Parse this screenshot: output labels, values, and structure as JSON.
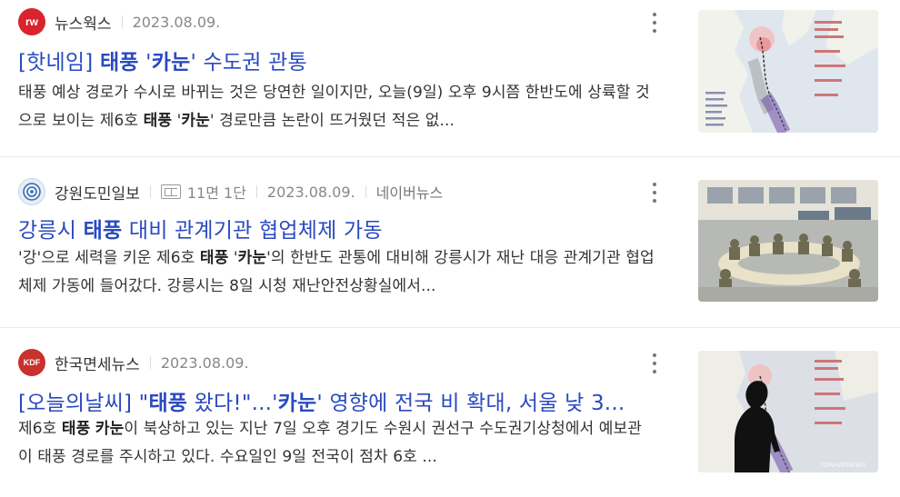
{
  "results": [
    {
      "source": "뉴스웍스",
      "date": "2023.08.09.",
      "title_parts": [
        {
          "text": "[핫네임] ",
          "bold": false
        },
        {
          "text": "태풍",
          "bold": true
        },
        {
          "text": " '",
          "bold": false
        },
        {
          "text": "카눈",
          "bold": true
        },
        {
          "text": "' 수도권 관통",
          "bold": false
        }
      ],
      "desc_parts": [
        {
          "text": "태풍 예상 경로가 수시로 바뀌는 것은 당연한 일이지만, 오늘(9일) 오후 9시쯤 한반도에 상륙할 것으로 보이는 제6호 ",
          "bold": false
        },
        {
          "text": "태풍",
          "bold": true
        },
        {
          "text": " '",
          "bold": false
        },
        {
          "text": "카눈",
          "bold": true
        },
        {
          "text": "' 경로만큼 논란이 뜨거웠던 적은 없...",
          "bold": false
        }
      ],
      "icon_color": "#d9232d",
      "icon_glyph": "rw"
    },
    {
      "source": "강원도민일보",
      "paper_section": "11면 1단",
      "date": "2023.08.09.",
      "portal": "네이버뉴스",
      "title_parts": [
        {
          "text": "강릉시 ",
          "bold": false
        },
        {
          "text": "태풍",
          "bold": true
        },
        {
          "text": " 대비 관계기관 협업체제 가동",
          "bold": false
        }
      ],
      "desc_parts": [
        {
          "text": "'강'으로 세력을 키운 제6호 ",
          "bold": false
        },
        {
          "text": "태풍",
          "bold": true
        },
        {
          "text": " '",
          "bold": false
        },
        {
          "text": "카눈",
          "bold": true
        },
        {
          "text": "'의 한반도 관통에 대비해 강릉시가 재난 대응 관계기관 협업체제 가동에 들어갔다. 강릉시는 8일 시청 재난안전상황실에서...",
          "bold": false
        }
      ],
      "icon_color": "#2b6cb0"
    },
    {
      "source": "한국면세뉴스",
      "date": "2023.08.09.",
      "title_parts": [
        {
          "text": "[오늘의날씨] \"",
          "bold": false
        },
        {
          "text": "태풍",
          "bold": true
        },
        {
          "text": " 왔다!\"...'",
          "bold": false
        },
        {
          "text": "카눈",
          "bold": true
        },
        {
          "text": "' 영향에 전국 비 확대, 서울 낮 3...",
          "bold": false
        }
      ],
      "desc_parts": [
        {
          "text": "제6호 ",
          "bold": false
        },
        {
          "text": "태풍",
          "bold": true
        },
        {
          "text": " ",
          "bold": false
        },
        {
          "text": "카눈",
          "bold": true
        },
        {
          "text": "이 북상하고 있는 지난 7일 오후 경기도 수원시 권선구 수도권기상청에서 예보관이 태풍 경로를 주시하고 있다. 수요일인 9일 전국이 점차 6호 ...",
          "bold": false
        }
      ],
      "icon_color": "#c8312e",
      "icon_glyph": "KDF",
      "thumb_watermark": "YONHAPNEWS"
    }
  ],
  "colors": {
    "title_link": "#2a4ac0",
    "meta_gray": "#888888",
    "divider": "#ebebeb"
  }
}
